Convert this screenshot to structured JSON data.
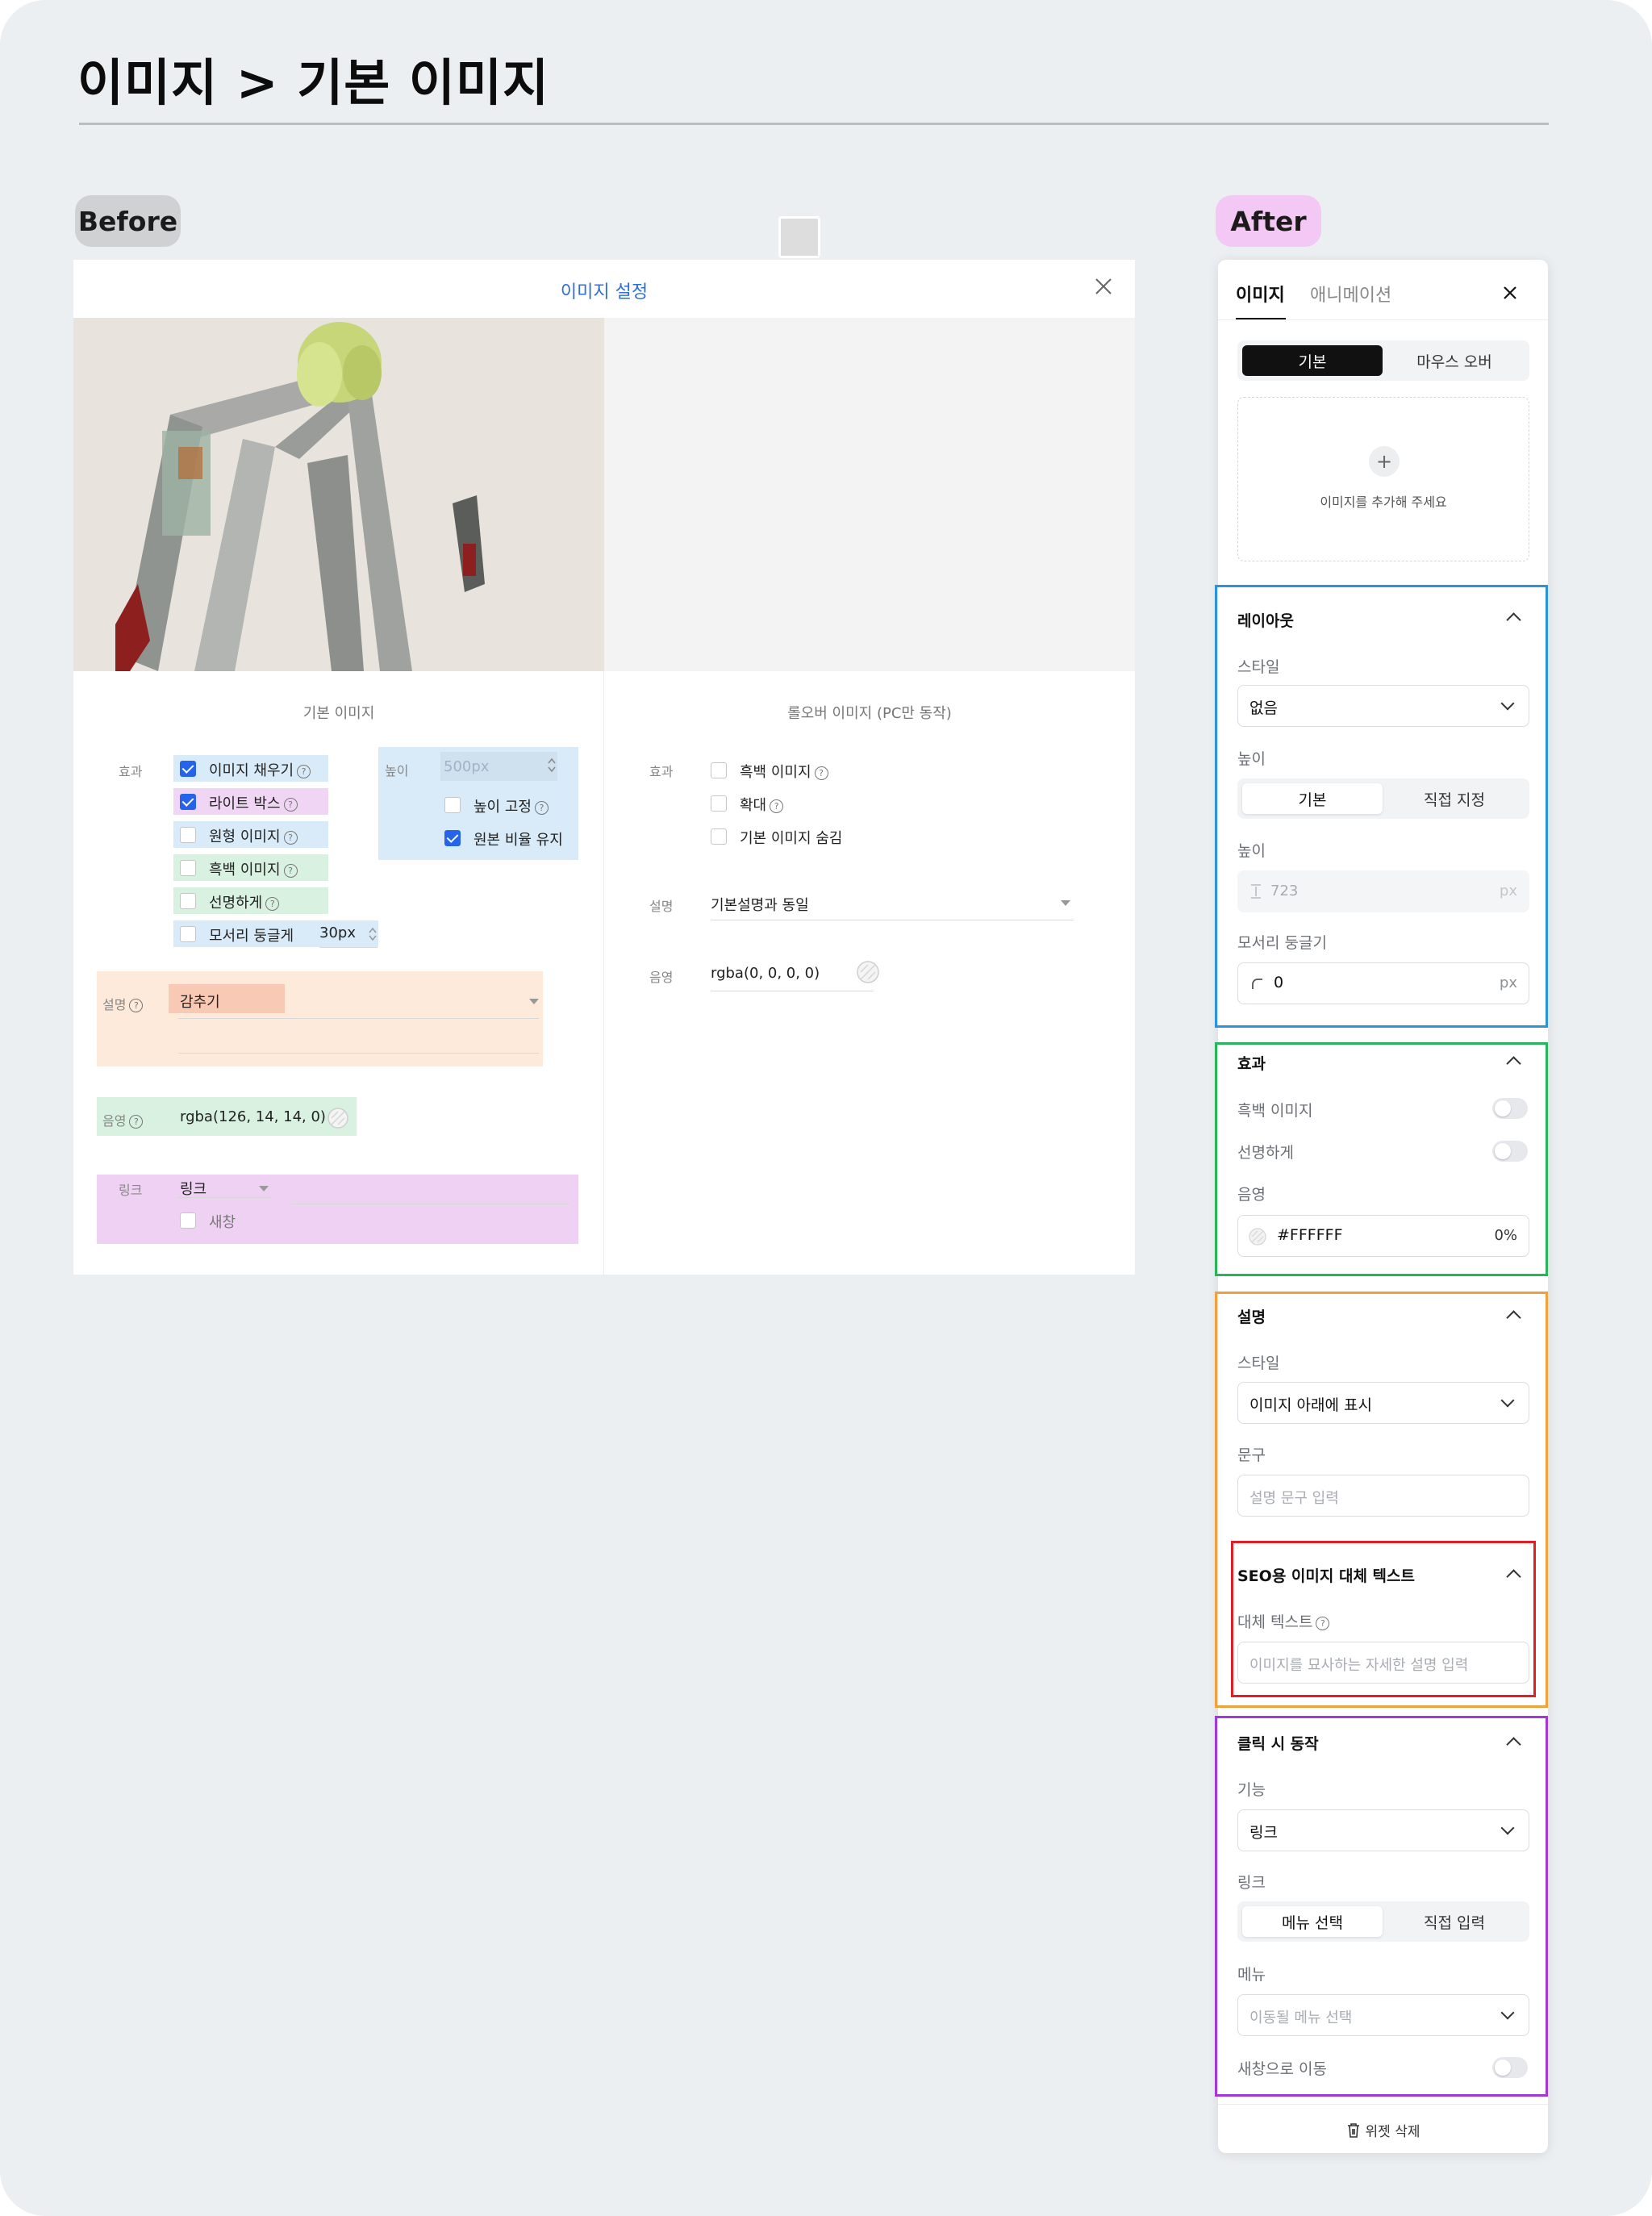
{
  "page_title": "이미지 > 기본 이미지",
  "before_label": "Before",
  "after_label": "After",
  "before": {
    "dialog_title": "이미지 설정",
    "basic_section_title": "기본 이미지",
    "rollover_section_title": "롤오버 이미지 (PC만 동작)",
    "effect_label": "효과",
    "effect_options": [
      {
        "label": "이미지 채우기",
        "checked": true
      },
      {
        "label": "라이트 박스",
        "checked": true
      },
      {
        "label": "원형 이미지",
        "checked": false
      },
      {
        "label": "흑백 이미지",
        "checked": false
      },
      {
        "label": "선명하게",
        "checked": false
      },
      {
        "label": "모서리 둥글게",
        "checked": false
      }
    ],
    "corner_radius_value": "30px",
    "height_label": "높이",
    "height_placeholder": "500px",
    "height_fixed_label": "높이 고정",
    "keep_ratio_label": "원본 비율 유지",
    "desc_label": "설명",
    "desc_value": "감추기",
    "shadow_label": "음영",
    "shadow_value": "rgba(126, 14, 14, 0)",
    "link_label": "링크",
    "link_value": "링크",
    "new_window_label": "새창",
    "rollover_effect_label": "효과",
    "rollover_options": [
      {
        "label": "흑백 이미지",
        "help": true
      },
      {
        "label": "확대",
        "help": true
      },
      {
        "label": "기본 이미지 숨김",
        "help": false
      }
    ],
    "rollover_desc_label": "설명",
    "rollover_desc_value": "기본설명과 동일",
    "rollover_shadow_label": "음영",
    "rollover_shadow_value": "rgba(0, 0, 0, 0)"
  },
  "after": {
    "tabs": [
      "이미지",
      "애니메이션"
    ],
    "state_toggle": [
      "기본",
      "마우스 오버"
    ],
    "dropzone_text": "이미지를 추가해 주세요",
    "layout": {
      "title": "레이아웃",
      "style_label": "스타일",
      "style_value": "없음",
      "height_label": "높이",
      "height_modes": [
        "기본",
        "직접 지정"
      ],
      "height_value_label": "높이",
      "height_value": "723",
      "unit": "px",
      "radius_label": "모서리 둥글기",
      "radius_value": "0"
    },
    "effect": {
      "title": "효과",
      "grayscale_label": "흑백 이미지",
      "sharpen_label": "선명하게",
      "shadow_label": "음영",
      "shadow_color": "#FFFFFF",
      "shadow_opacity": "0%"
    },
    "description": {
      "title": "설명",
      "style_label": "스타일",
      "style_value": "이미지 아래에 표시",
      "text_label": "문구",
      "text_placeholder": "설명 문구 입력"
    },
    "seo": {
      "title": "SEO용 이미지 대체 텍스트",
      "alt_label": "대체 텍스트",
      "alt_placeholder": "이미지를 묘사하는 자세한 설명 입력"
    },
    "click": {
      "title": "클릭 시 동작",
      "function_label": "기능",
      "function_value": "링크",
      "link_label": "링크",
      "link_modes": [
        "메뉴 선택",
        "직접 입력"
      ],
      "menu_label": "메뉴",
      "menu_placeholder": "이동될 메뉴 선택",
      "new_window_label": "새창으로 이동"
    },
    "delete_label": "위젯 삭제"
  },
  "colors": {
    "blue_box": "#2c93d8",
    "green_box": "#28b45a",
    "orange_box": "#f0a13b",
    "red_box": "#e01f26",
    "purple_box": "#a338d8",
    "checkbox_on": "#2563eb",
    "dialog_title": "#2d6fd6"
  }
}
